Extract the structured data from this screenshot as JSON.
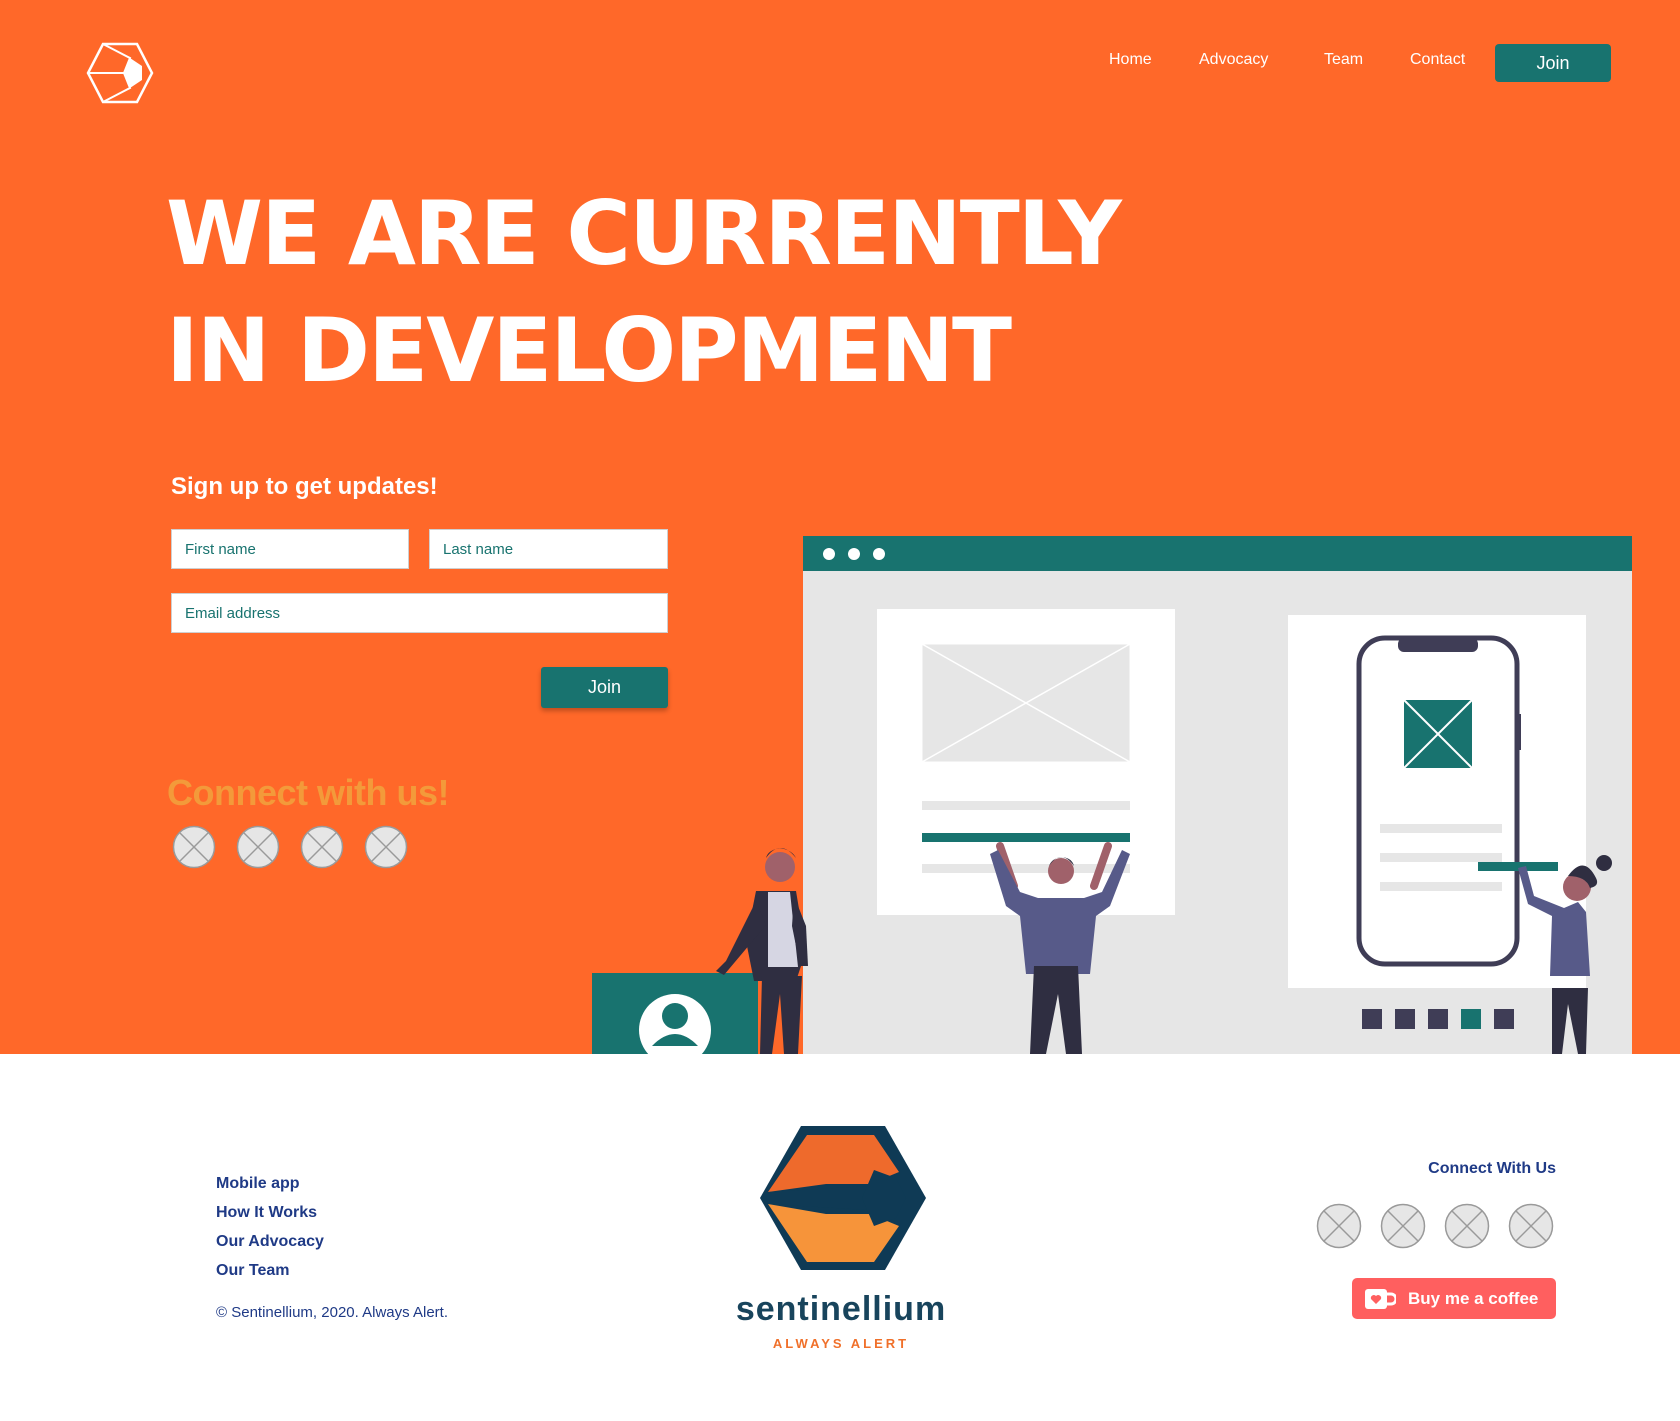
{
  "nav": {
    "links": [
      "Home",
      "Advocacy",
      "Team",
      "Contact"
    ],
    "join_label": "Join"
  },
  "hero": {
    "headline_line1": "WE ARE CURRENTLY",
    "headline_line2": "IN DEVELOPMENT"
  },
  "signup": {
    "title": "Sign up to get updates!",
    "first_name_placeholder": "First name",
    "last_name_placeholder": "Last name",
    "email_placeholder": "Email address",
    "join_label": "Join"
  },
  "connect": {
    "title": "Connect with us!",
    "icons": [
      "social-placeholder-icon",
      "social-placeholder-icon",
      "social-placeholder-icon",
      "social-placeholder-icon"
    ]
  },
  "footer": {
    "links": [
      "Mobile app",
      "How It Works",
      "Our Advocacy",
      "Our Team"
    ],
    "copyright": "© Sentinellium, 2020. Always Alert.",
    "brand_name": "sentinellium",
    "tagline": "ALWAYS ALERT",
    "connect_title": "Connect With Us",
    "coffee_label": "Buy me a coffee"
  },
  "colors": {
    "hero_bg": "#FF6829",
    "accent_teal": "#18736F",
    "navy": "#1F3A86",
    "coffee": "#FF5F5F"
  }
}
